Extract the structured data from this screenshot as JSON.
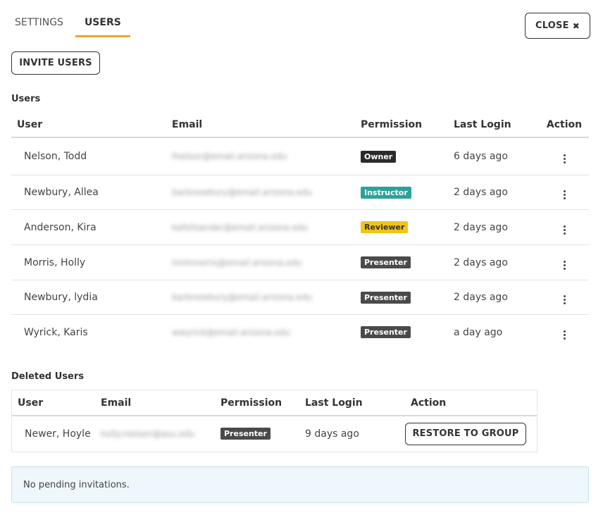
{
  "tabs": [
    {
      "label": "SETTINGS",
      "active": false
    },
    {
      "label": "USERS",
      "active": true
    }
  ],
  "close_button": {
    "label": "CLOSE",
    "icon": "close-icon"
  },
  "invite_button": {
    "label": "INVITE USERS"
  },
  "users_section": {
    "title": "Users",
    "columns": [
      "User",
      "Email",
      "Permission",
      "Last Login",
      "Action"
    ],
    "rows": [
      {
        "user": "Nelson,  Todd",
        "email": "fnelson@email.arizona.edu",
        "permission": "Owner",
        "last_login": "6 days ago"
      },
      {
        "user": "Newbury,  Allea",
        "email": "barbnewbury@email.arizona.edu",
        "permission": "Instructor",
        "last_login": "2 days ago"
      },
      {
        "user": "Anderson, Kira",
        "email": "kafeilsander@email.arizona.edu",
        "permission": "Reviewer",
        "last_login": "2 days ago"
      },
      {
        "user": "Morris, Holly",
        "email": "hmhmorris@email.arizona.edu",
        "permission": "Presenter",
        "last_login": "2 days ago"
      },
      {
        "user": "Newbury, lydia",
        "email": "barbnewbury@email.arizona.edu",
        "permission": "Presenter",
        "last_login": "2 days ago"
      },
      {
        "user": "Wyrick, Karis",
        "email": "wwyrick@email.arizona.edu",
        "permission": "Presenter",
        "last_login": "a day ago"
      }
    ]
  },
  "deleted_section": {
    "title": "Deleted Users",
    "columns": [
      "User",
      "Email",
      "Permission",
      "Last Login",
      "Action"
    ],
    "rows": [
      {
        "user": "Newer, Hoyle",
        "email": "holly.nielsen@asu.edu",
        "permission": "Presenter",
        "last_login": "9 days ago",
        "action_label": "RESTORE TO GROUP"
      }
    ]
  },
  "notice": "No pending invitations.",
  "colors": {
    "tab_accent": "#f0a030",
    "owner": "#2b2b2b",
    "instructor": "#2aa39a",
    "reviewer": "#f2c418",
    "presenter": "#4a4a4a",
    "notice_bg": "#eef7fb"
  }
}
